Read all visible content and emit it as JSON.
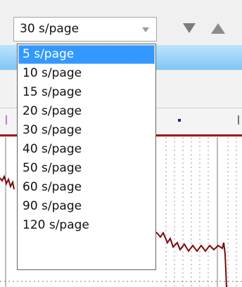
{
  "combo": {
    "value": "30 s/page",
    "arrow_icon": "chevron-down-icon"
  },
  "nav": {
    "down_icon": "triangle-down-icon",
    "up_icon": "triangle-up-icon"
  },
  "dropdown": {
    "selected_index": 0,
    "options": [
      "5 s/page",
      "10 s/page",
      "15 s/page",
      "20 s/page",
      "30 s/page",
      "40 s/page",
      "50 s/page",
      "60 s/page",
      "90 s/page",
      "120 s/page"
    ]
  },
  "colors": {
    "selection": "#3399ff",
    "trace": "#7a0a0a",
    "grid": "#9a9a9a",
    "blue_strip": "#7fc6f6"
  }
}
